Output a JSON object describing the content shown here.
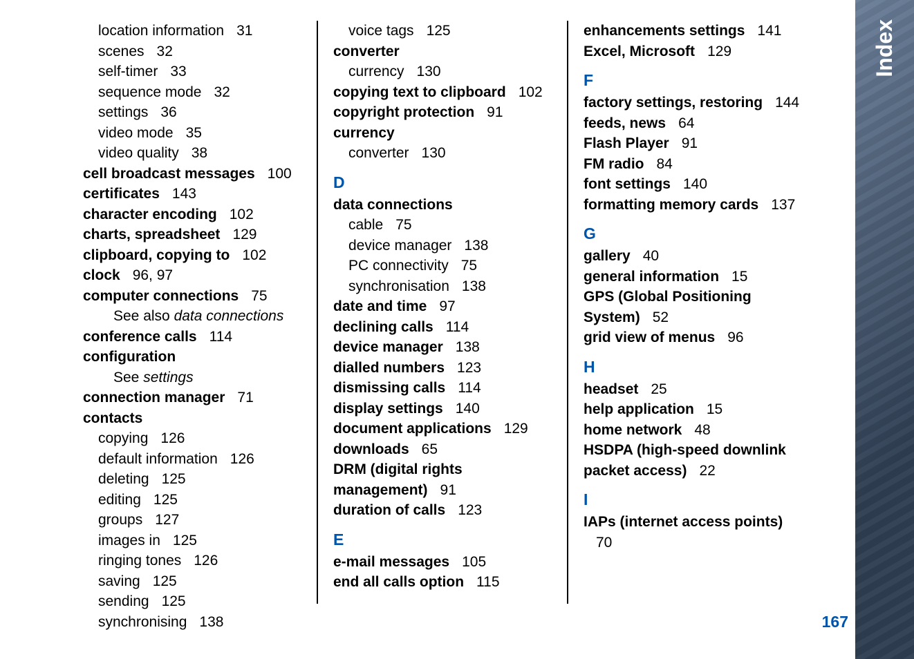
{
  "tab_title": "Index",
  "page_number": "167",
  "columns": [
    [
      {
        "text": "location information",
        "page": "31",
        "style": "sub"
      },
      {
        "text": "scenes",
        "page": "32",
        "style": "sub"
      },
      {
        "text": "self-timer",
        "page": "33",
        "style": "sub"
      },
      {
        "text": "sequence mode",
        "page": "32",
        "style": "sub"
      },
      {
        "text": "settings",
        "page": "36",
        "style": "sub"
      },
      {
        "text": "video mode",
        "page": "35",
        "style": "sub"
      },
      {
        "text": "video quality",
        "page": "38",
        "style": "sub"
      },
      {
        "text": "cell broadcast messages",
        "page": "100",
        "style": "bold"
      },
      {
        "text": "certificates",
        "page": "143",
        "style": "bold"
      },
      {
        "text": "character encoding",
        "page": "102",
        "style": "bold"
      },
      {
        "text": "charts, spreadsheet",
        "page": "129",
        "style": "bold"
      },
      {
        "text": "clipboard, copying to",
        "page": "102",
        "style": "bold"
      },
      {
        "text": "clock",
        "page": "96, 97",
        "style": "bold"
      },
      {
        "text": "computer connections",
        "page": "75",
        "style": "bold"
      },
      {
        "text": "See also ",
        "ref": "data connections",
        "style": "sub2 italic-ref"
      },
      {
        "text": "conference calls",
        "page": "114",
        "style": "bold"
      },
      {
        "text": "configuration",
        "page": "",
        "style": "bold"
      },
      {
        "text": "See ",
        "ref": "settings",
        "style": "sub2 italic-ref"
      },
      {
        "text": "connection manager",
        "page": "71",
        "style": "bold"
      },
      {
        "text": "contacts",
        "page": "",
        "style": "bold"
      },
      {
        "text": "copying",
        "page": "126",
        "style": "sub"
      },
      {
        "text": "default information",
        "page": "126",
        "style": "sub"
      },
      {
        "text": "deleting",
        "page": "125",
        "style": "sub"
      },
      {
        "text": "editing",
        "page": "125",
        "style": "sub"
      },
      {
        "text": "groups",
        "page": "127",
        "style": "sub"
      },
      {
        "text": "images in",
        "page": "125",
        "style": "sub"
      },
      {
        "text": "ringing tones",
        "page": "126",
        "style": "sub"
      },
      {
        "text": "saving",
        "page": "125",
        "style": "sub"
      },
      {
        "text": "sending",
        "page": "125",
        "style": "sub"
      },
      {
        "text": "synchronising",
        "page": "138",
        "style": "sub"
      }
    ],
    [
      {
        "text": "voice tags",
        "page": "125",
        "style": "sub"
      },
      {
        "text": "converter",
        "page": "",
        "style": "bold"
      },
      {
        "text": "currency",
        "page": "130",
        "style": "sub"
      },
      {
        "text": "copying text to clipboard",
        "page": "102",
        "style": "bold"
      },
      {
        "text": "copyright protection",
        "page": "91",
        "style": "bold"
      },
      {
        "text": "currency",
        "page": "",
        "style": "bold"
      },
      {
        "text": "converter",
        "page": "130",
        "style": "sub"
      },
      {
        "letter": "D"
      },
      {
        "text": "data connections",
        "page": "",
        "style": "bold"
      },
      {
        "text": "cable",
        "page": "75",
        "style": "sub"
      },
      {
        "text": "device manager",
        "page": "138",
        "style": "sub"
      },
      {
        "text": "PC connectivity",
        "page": "75",
        "style": "sub"
      },
      {
        "text": "synchronisation",
        "page": "138",
        "style": "sub"
      },
      {
        "text": "date and time",
        "page": "97",
        "style": "bold"
      },
      {
        "text": "declining calls",
        "page": "114",
        "style": "bold"
      },
      {
        "text": "device manager",
        "page": "138",
        "style": "bold"
      },
      {
        "text": "dialled numbers",
        "page": "123",
        "style": "bold"
      },
      {
        "text": "dismissing calls",
        "page": "114",
        "style": "bold"
      },
      {
        "text": "display settings",
        "page": "140",
        "style": "bold"
      },
      {
        "text": "document applications",
        "page": "129",
        "style": "bold"
      },
      {
        "text": "downloads",
        "page": "65",
        "style": "bold"
      },
      {
        "text": "DRM (digital rights management)",
        "page": "91",
        "style": "bold"
      },
      {
        "text": "duration of calls",
        "page": "123",
        "style": "bold"
      },
      {
        "letter": "E"
      },
      {
        "text": "e-mail messages",
        "page": "105",
        "style": "bold"
      },
      {
        "text": "end all calls option",
        "page": "115",
        "style": "bold"
      }
    ],
    [
      {
        "text": "enhancements settings",
        "page": "141",
        "style": "bold"
      },
      {
        "text": "Excel, Microsoft",
        "page": "129",
        "style": "bold"
      },
      {
        "letter": "F"
      },
      {
        "text": "factory settings, restoring",
        "page": "144",
        "style": "bold"
      },
      {
        "text": "feeds, news",
        "page": "64",
        "style": "bold"
      },
      {
        "text": "Flash Player",
        "page": "91",
        "style": "bold"
      },
      {
        "text": "FM radio",
        "page": "84",
        "style": "bold"
      },
      {
        "text": "font settings",
        "page": "140",
        "style": "bold"
      },
      {
        "text": "formatting memory cards",
        "page": "137",
        "style": "bold"
      },
      {
        "letter": "G"
      },
      {
        "text": "gallery",
        "page": "40",
        "style": "bold"
      },
      {
        "text": "general information",
        "page": "15",
        "style": "bold"
      },
      {
        "text": "GPS (Global Positioning System)",
        "page": "52",
        "style": "bold"
      },
      {
        "text": "grid view of menus",
        "page": "96",
        "style": "bold"
      },
      {
        "letter": "H"
      },
      {
        "text": "headset",
        "page": "25",
        "style": "bold"
      },
      {
        "text": "help application",
        "page": "15",
        "style": "bold"
      },
      {
        "text": "home network",
        "page": "48",
        "style": "bold"
      },
      {
        "text": "HSDPA (high-speed downlink packet access)",
        "page": "22",
        "style": "bold"
      },
      {
        "letter": "I"
      },
      {
        "text": "IAPs (internet access points)",
        "page": "70",
        "style": "bold"
      }
    ]
  ]
}
